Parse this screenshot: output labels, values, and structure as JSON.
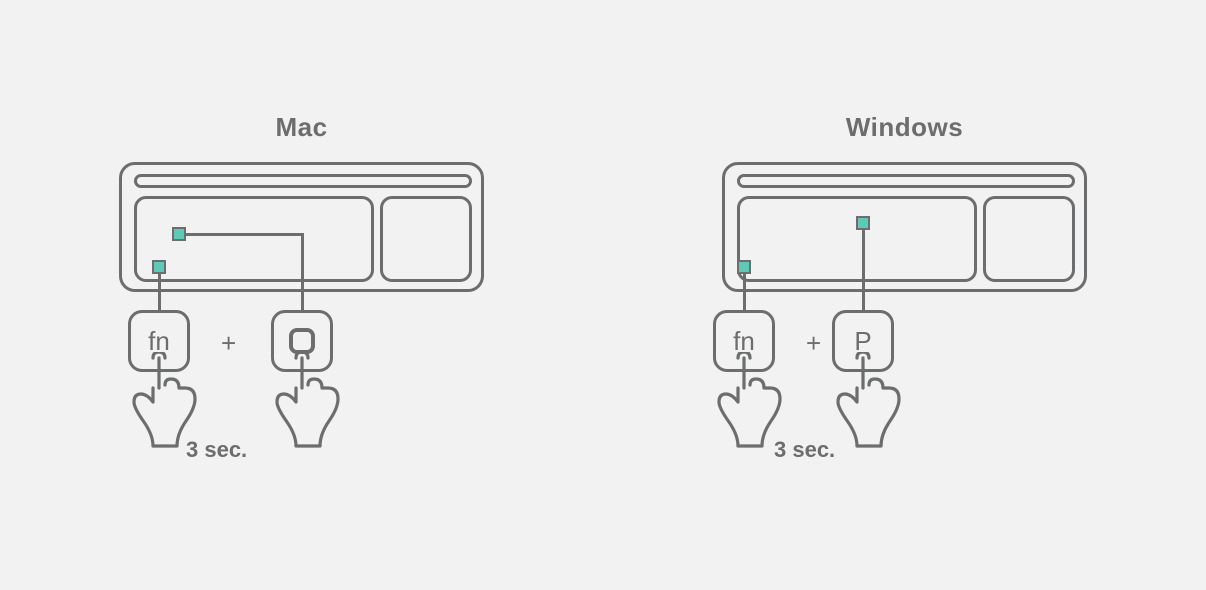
{
  "accent_color": "#5fc9b8",
  "mac": {
    "title": "Mac",
    "key1_label": "fn",
    "plus": "+",
    "key2_label": "O",
    "key2_render": "o-glyph",
    "duration": "3 sec."
  },
  "windows": {
    "title": "Windows",
    "key1_label": "fn",
    "plus": "+",
    "key2_label": "P",
    "key2_render": "text",
    "duration": "3 sec."
  }
}
